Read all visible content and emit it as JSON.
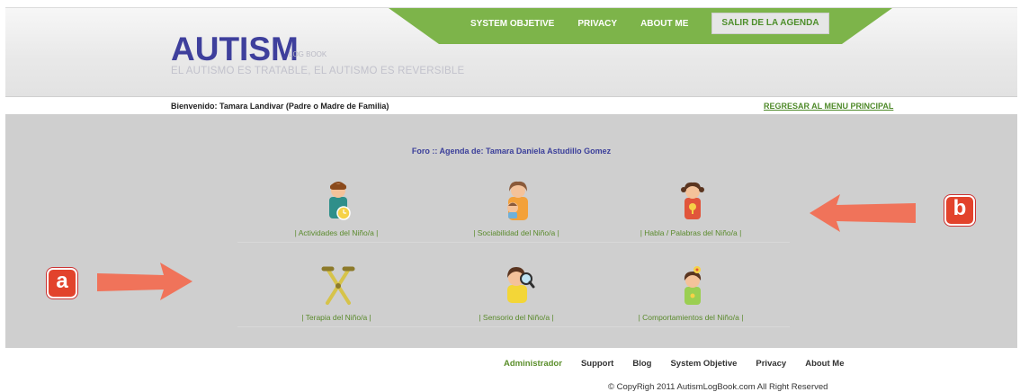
{
  "header": {
    "logo": "AUTISM",
    "logo_small": "LOG BOOK",
    "tagline": "EL AUTISMO ES TRATABLE, EL AUTISMO ES REVERSIBLE",
    "nav": [
      "SYSTEM OBJETIVE",
      "PRIVACY",
      "ABOUT ME",
      "SALIR DE LA AGENDA"
    ],
    "nav_color": "#7db44a"
  },
  "welcome": "Bienvenido: Tamara Landivar (Padre o Madre de Familia)",
  "back_link": "REGRESAR AL MENU PRINCIPAL",
  "main": {
    "forum_title": "Foro :: Agenda de: Tamara Daniela Astudillo Gomez",
    "tiles": [
      {
        "label": "| Actividades del Niño/a |",
        "icon": "boy-clock-icon"
      },
      {
        "label": "| Sociabilidad del Niño/a |",
        "icon": "mother-child-icon"
      },
      {
        "label": "| Habla / Palabras del Niño/a |",
        "icon": "girl-speech-icon"
      },
      {
        "label": "| Terapia del Niño/a |",
        "icon": "crutches-icon"
      },
      {
        "label": "| Sensorio del Niño/a |",
        "icon": "girl-magnifier-icon"
      },
      {
        "label": "| Comportamientos del Niño/a |",
        "icon": "girl-flower-icon"
      }
    ]
  },
  "annotations": {
    "left_badge": "a",
    "right_badge": "b",
    "arrow_color": "#f0735a",
    "badge_color": "#e2432c"
  },
  "footer": {
    "links": [
      "Administrador",
      "Support",
      "Blog",
      "System Objetive",
      "Privacy",
      "About Me"
    ],
    "copyright": "© CopyRigh 2011 AutismLogBook.com All Right Reserved"
  }
}
